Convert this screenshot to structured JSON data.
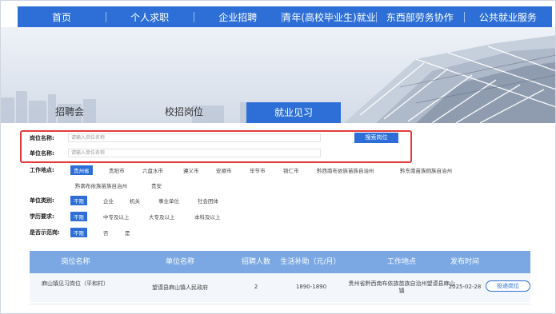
{
  "nav": {
    "items": [
      "首页",
      "个人求职",
      "企业招聘",
      "青年(高校毕业生)就业",
      "东西部劳务协作",
      "公共就业服务"
    ]
  },
  "tabs": [
    "招聘会",
    "校招岗位",
    "就业见习"
  ],
  "search": {
    "position_label": "岗位名称:",
    "position_placeholder": "请输入岗位名称",
    "unit_label": "单位名称:",
    "unit_placeholder": "请输入单位名称",
    "button": "搜索岗位"
  },
  "filters": {
    "location": {
      "label": "工作地点:",
      "options_row1": [
        "贵州省",
        "贵阳市",
        "六盘水市",
        "遵义市",
        "安顺市",
        "毕节市",
        "铜仁市",
        "黔西南布依族苗族自治州",
        "黔东南苗族侗族自治州"
      ],
      "options_row2": [
        "黔南布依族苗族自治州",
        "贵安"
      ]
    },
    "unit_type": {
      "label": "单位类别:",
      "options": [
        "不限",
        "企业",
        "机关",
        "事业单位",
        "社会团体"
      ]
    },
    "education": {
      "label": "学历要求:",
      "options": [
        "不限",
        "中专及以上",
        "大专及以上",
        "本科及以上"
      ]
    },
    "show_full": {
      "label": "是否示范岗:",
      "options": [
        "不限",
        "否",
        "是"
      ]
    }
  },
  "table": {
    "headers": [
      "岗位名称",
      "单位名称",
      "招聘人数",
      "生活补助（元/月）",
      "工作地点",
      "发布时间"
    ],
    "rows": [
      {
        "name": "麻山镇见习岗位（平和村）",
        "unit": "望谟县麻山镇人民政府",
        "count": "2",
        "subsidy": "1890-1890",
        "location": "贵州省黔西南布依族苗族自治州望谟县麻山镇",
        "date": "2025-02-28",
        "action": "投递岗位"
      }
    ]
  },
  "colors": {
    "primary": "#2d6fd6",
    "header_bg": "#7ba8e3",
    "highlight_border": "#e53b3b"
  }
}
